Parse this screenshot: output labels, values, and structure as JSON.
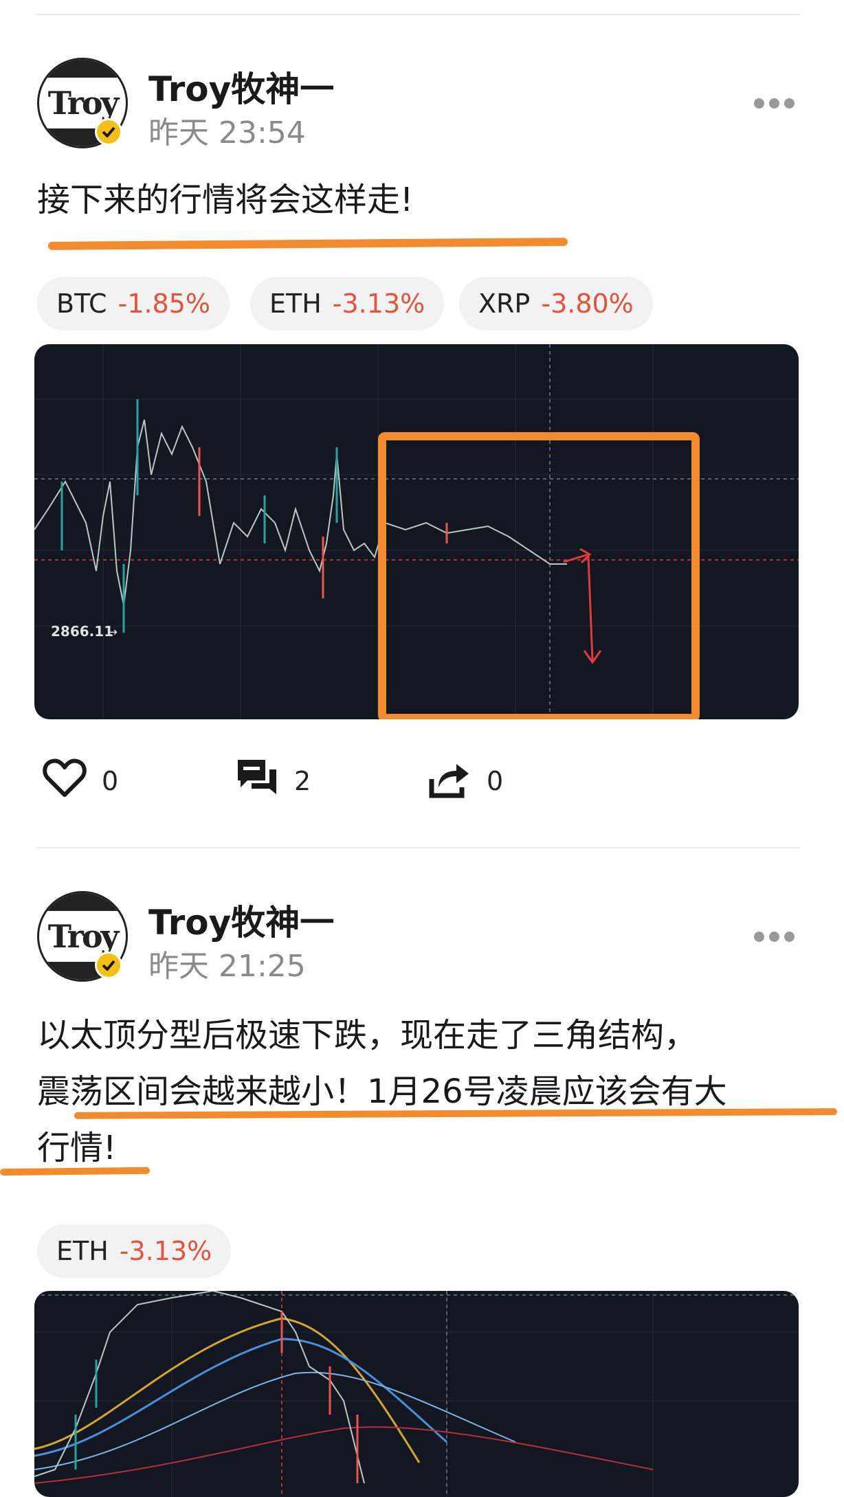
{
  "posts": [
    {
      "author": "Troy牧神一",
      "avatar_text": "Troy",
      "time": "昨天 23:54",
      "text": "接下来的行情将会这样走!",
      "tickers": [
        {
          "symbol": "BTC",
          "change": "-1.85%"
        },
        {
          "symbol": "ETH",
          "change": "-3.13%"
        },
        {
          "symbol": "XRP",
          "change": "-3.80%"
        }
      ],
      "chart_label": "2866.11",
      "likes": "0",
      "comments": "2",
      "shares": "0"
    },
    {
      "author": "Troy牧神一",
      "avatar_text": "Troy",
      "time": "昨天 21:25",
      "text_line1": "以太顶分型后极速下跌，现在走了三角结构，",
      "text_line2": "震荡区间会越来越小！1月26号凌晨应该会有大",
      "text_line3": "行情!",
      "tickers": [
        {
          "symbol": "ETH",
          "change": "-3.13%"
        }
      ]
    }
  ],
  "colors": {
    "accent_orange": "#f28a2e",
    "negative": "#e4523a",
    "chart_bg": "#131722",
    "verified": "#f3c116"
  },
  "icons": [
    "more-icon",
    "heart-icon",
    "comment-icon",
    "share-icon",
    "verified-badge-icon"
  ]
}
